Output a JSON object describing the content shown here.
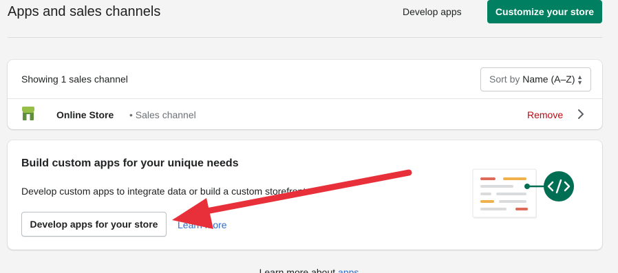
{
  "header": {
    "title": "Apps and sales channels",
    "develop_apps_label": "Develop apps",
    "customize_label": "Customize your store"
  },
  "channels": {
    "showing_text": "Showing 1 sales channel",
    "sort": {
      "prefix": "Sort by",
      "value": "Name (A–Z)"
    },
    "items": [
      {
        "name": "Online Store",
        "subtitle": "• Sales channel",
        "remove_label": "Remove",
        "icon": "store-icon"
      }
    ]
  },
  "custom_apps": {
    "heading": "Build custom apps for your unique needs",
    "description": "Develop custom apps to integrate data or build a custom storefront.",
    "button_label": "Develop apps for your store",
    "learn_more_label": "Learn more",
    "illustration": "code-icon"
  },
  "footer": {
    "prefix": "Learn more about",
    "link_label": "apps"
  },
  "annotation": {
    "type": "red-arrow",
    "color": "#e8303a"
  },
  "colors": {
    "primary": "#008060",
    "critical": "#bf0711",
    "link": "#2c6ecb"
  }
}
